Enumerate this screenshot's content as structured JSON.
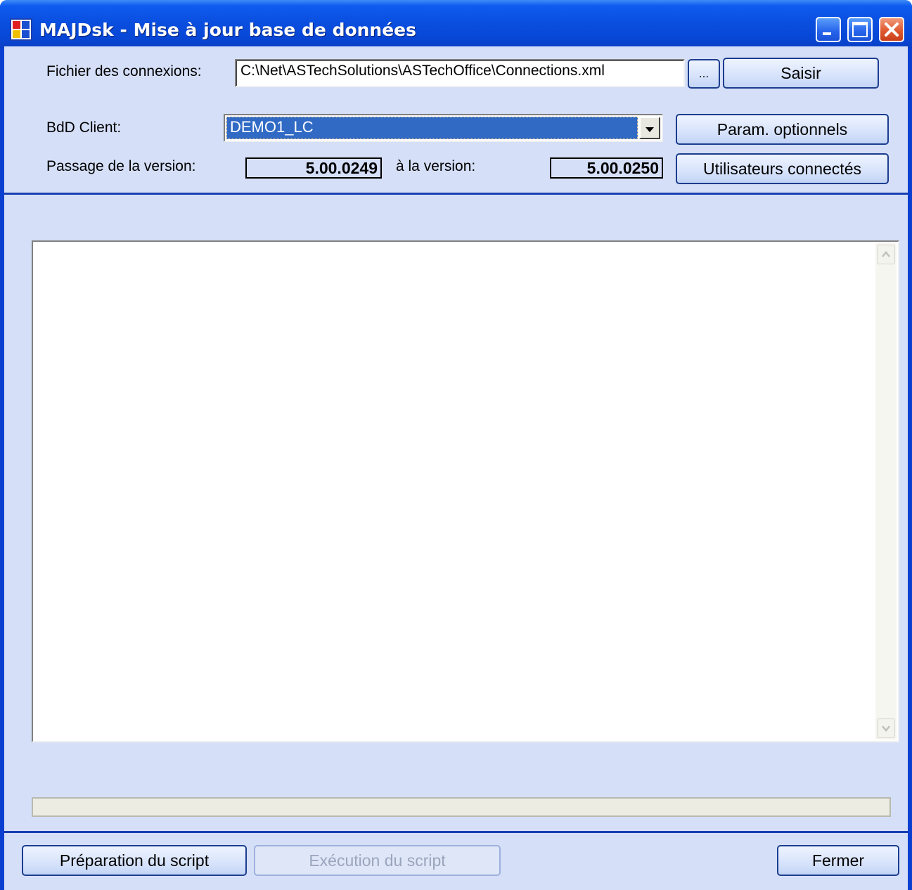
{
  "window": {
    "title": "MAJDsk - Mise à jour base de données",
    "title_bar_color": "#0a4fe0",
    "client_color": "#d5dff8"
  },
  "connections": {
    "label": "Fichier des connexions:",
    "value": "C:\\Net\\ASTechSolutions\\ASTechOffice\\Connections.xml",
    "browse_label": "...",
    "saisir_label": "Saisir"
  },
  "client_db": {
    "label": "BdD Client:",
    "selected": "DEMO1_LC",
    "params_label": "Param. optionnels"
  },
  "version": {
    "from_label": "Passage de la version:",
    "from_value": "5.00.0249",
    "to_label": "à la version:",
    "to_value": "5.00.0250",
    "users_label": "Utilisateurs connectés"
  },
  "log": {
    "content": ""
  },
  "progress": {
    "fraction": 0
  },
  "footer": {
    "prepare_label": "Préparation du script",
    "execute_label": "Exécution du script",
    "close_label": "Fermer"
  }
}
